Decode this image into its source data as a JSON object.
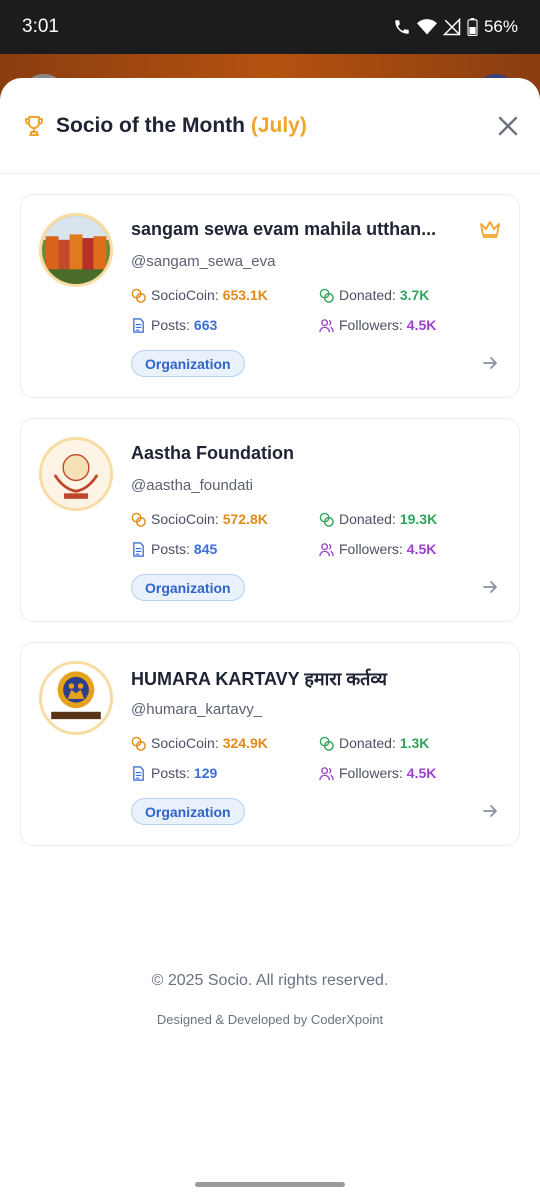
{
  "status_bar": {
    "time": "3:01",
    "battery": "56%"
  },
  "sheet": {
    "title": "Socio of the Month",
    "month": "(July)",
    "icon": "trophy-icon",
    "close_icon": "close-icon",
    "accent": "#f2a52c"
  },
  "labels": {
    "socio_coin": "SocioCoin:",
    "donated": "Donated:",
    "posts": "Posts:",
    "followers": "Followers:"
  },
  "cards": [
    {
      "name": "sangam sewa evam mahila utthan...",
      "handle": "@sangam_sewa_eva",
      "socio_coin": "653.1K",
      "donated": "3.7K",
      "posts": "663",
      "followers": "4.5K",
      "badge": "Organization",
      "top_icon": "crown-icon"
    },
    {
      "name": "Aastha Foundation",
      "handle": "@aastha_foundati",
      "socio_coin": "572.8K",
      "donated": "19.3K",
      "posts": "845",
      "followers": "4.5K",
      "badge": "Organization"
    },
    {
      "name": "HUMARA KARTAVY हमारा कर्तव्य",
      "handle": "@humara_kartavy_",
      "socio_coin": "324.9K",
      "donated": "1.3K",
      "posts": "129",
      "followers": "4.5K",
      "badge": "Organization"
    }
  ],
  "footer": {
    "copyright": "© 2025 Socio. All rights reserved.",
    "credit": "Designed & Developed by CoderXpoint"
  },
  "colors": {
    "coin": "#e08a1a",
    "donated": "#2fa55c",
    "posts": "#3a6fd8",
    "followers": "#9b3fcf",
    "badge": "#2f64c8"
  }
}
